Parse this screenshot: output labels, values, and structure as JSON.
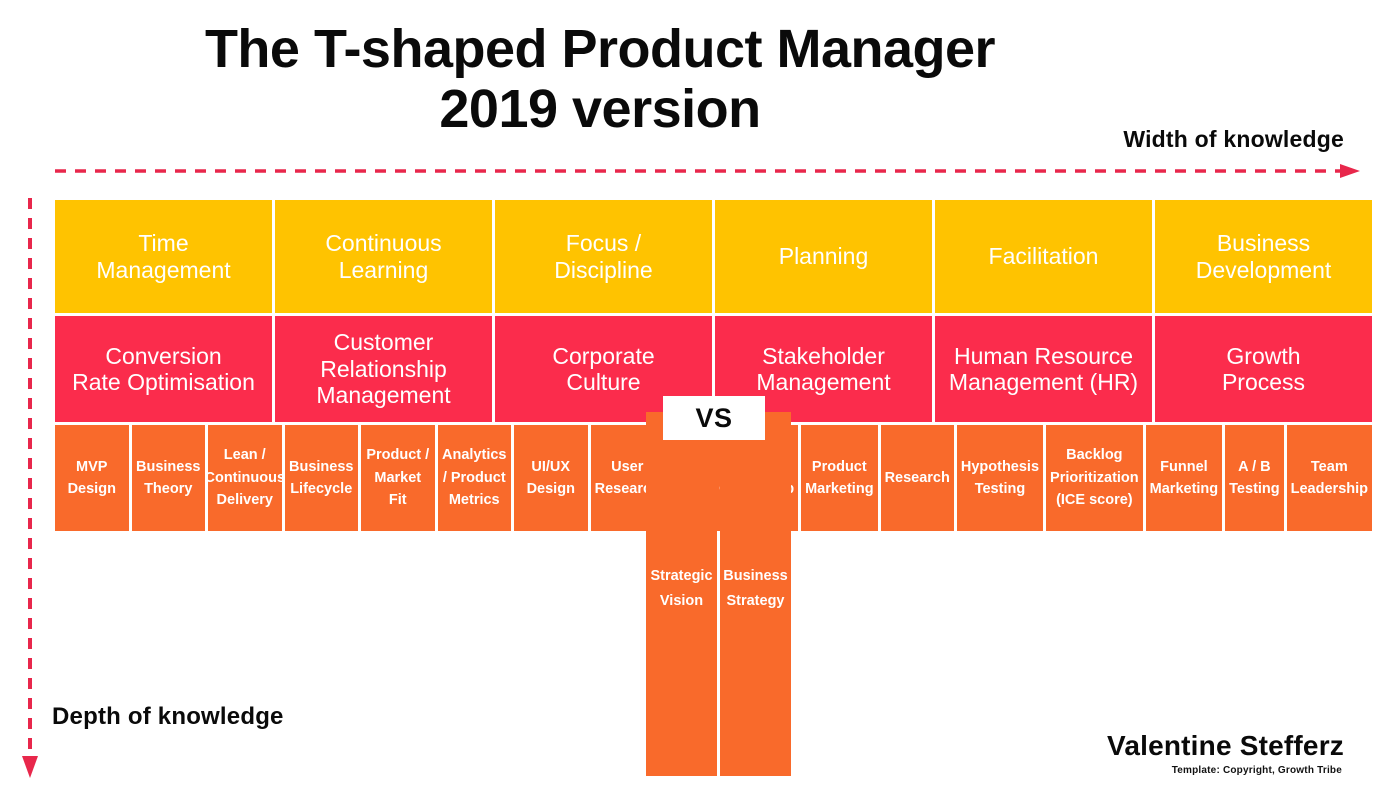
{
  "title": {
    "line1": "The T-shaped Product Manager",
    "line2": "2019 version"
  },
  "axes": {
    "width_label": "Width of knowledge",
    "depth_label": "Depth of knowledge",
    "horizontal_arrow_icon": "dashed-arrow-right-icon",
    "vertical_arrow_icon": "dashed-arrow-down-icon"
  },
  "vs_badge": "VS",
  "colors": {
    "yellow": "#FFC300",
    "pink": "#FB2C4C",
    "orange": "#F96A2B",
    "arrow": "#E8274B",
    "text_dark": "#0A0A0A"
  },
  "rows": {
    "soft_skills": [
      "Time\nManagement",
      "Continuous\nLearning",
      "Focus /\nDiscipline",
      "Planning",
      "Facilitation",
      "Business\nDevelopment"
    ],
    "domains": [
      "Conversion\nRate Optimisation",
      "Customer\nRelationship\nManagement",
      "Corporate\nCulture",
      "Stakeholder\nManagement",
      "Human Resource\nManagement (HR)",
      "Growth\nProcess"
    ],
    "skills_left": [
      "MVP\nDesign",
      "Business\nTheory",
      "Lean /\nContinuous\nDelivery",
      "Business\nLifecycle",
      "Product /\nMarket Fit",
      "Analytics\n/ Product\nMetrics",
      "UI/UX\nDesign",
      "User\nResearch"
    ],
    "skills_stem_top": [
      "",
      ""
    ],
    "skills_right": [
      "Product\nOwnership",
      "Product\nMarketing",
      "Research",
      "Hypothesis\nTesting",
      "Backlog\nPrioritization\n(ICE score)",
      "Funnel\nMarketing",
      "A / B\nTesting",
      "Team\nLeadership"
    ]
  },
  "stem": {
    "cells": [
      "Strategic\nVision",
      "Business\nStrategy"
    ]
  },
  "footer": {
    "author": "Valentine Stefferz",
    "credit": "Template: Copyright, Growth Tribe"
  }
}
